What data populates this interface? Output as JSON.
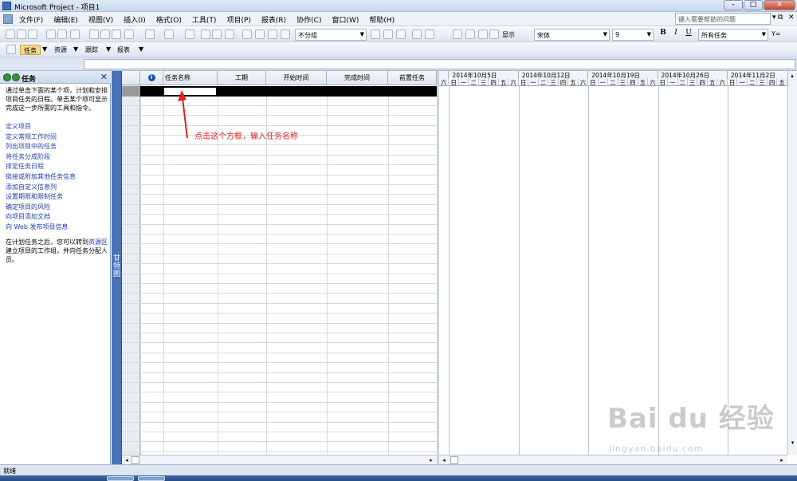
{
  "window": {
    "title": "Microsoft Project - 项目1"
  },
  "menu": {
    "items": [
      "文件(F)",
      "编辑(E)",
      "视图(V)",
      "插入(I)",
      "格式(O)",
      "工具(T)",
      "项目(P)",
      "报表(R)",
      "协作(C)",
      "窗口(W)",
      "帮助(H)"
    ],
    "help_placeholder": "键入需要帮助的问题"
  },
  "toolbar": {
    "group_combo": "不分组",
    "show_label": "显示",
    "font_combo": "宋体",
    "size_combo": "9",
    "bold": "B",
    "italic": "I",
    "underline": "U",
    "filter_combo": "所有任务",
    "filter_icon": "Y="
  },
  "guide_toolbar": {
    "items": [
      "任务",
      "资源",
      "跟踪",
      "报表"
    ]
  },
  "taskpane": {
    "title": "任务",
    "description": "通过单击下面的某个项，计划和安排项目任务的日程。单击某个项可显示完成这一步所需的工具和指令。",
    "links": [
      "定义项目",
      "定义常规工作时间",
      "列出项目中的任务",
      "将任务分成阶段",
      "排定任务日程",
      "链接或附加其他任务信息",
      "添加自定义信息列",
      "设置期限和限制任务",
      "确定项目的风险",
      "向项目添加文档",
      "向 Web 发布项目信息"
    ],
    "note_before": "在计划任务之后，您可以转到",
    "note_link": "资源区",
    "note_after": "建立项目的工作组，并向任务分配人员。"
  },
  "viewbar": {
    "label": "甘特图"
  },
  "table": {
    "headers": [
      "任务名称",
      "工期",
      "开始时间",
      "完成时间",
      "前置任务"
    ],
    "indicator_icon": "info-icon",
    "row_count": 37
  },
  "gantt": {
    "weeks": [
      "2014年10月5日",
      "2014年10月12日",
      "2014年10月19日",
      "2014年10月26日",
      "2014年11月2日"
    ],
    "days": [
      "六",
      "日",
      "一",
      "二",
      "三",
      "四",
      "五",
      "六",
      "日",
      "一",
      "二",
      "三",
      "四",
      "五",
      "六",
      "日",
      "一",
      "二",
      "三",
      "四",
      "五",
      "六",
      "日",
      "一",
      "二",
      "三",
      "四",
      "五",
      "六",
      "日",
      "一",
      "二",
      "三",
      "四",
      "五"
    ]
  },
  "annotation": {
    "text": "点击这个方框，输入任务名称",
    "color": "#e0201a"
  },
  "status": {
    "text": "就绪"
  },
  "watermark": {
    "main": "Bai du 经验",
    "sub": "jingyan.baidu.com"
  }
}
